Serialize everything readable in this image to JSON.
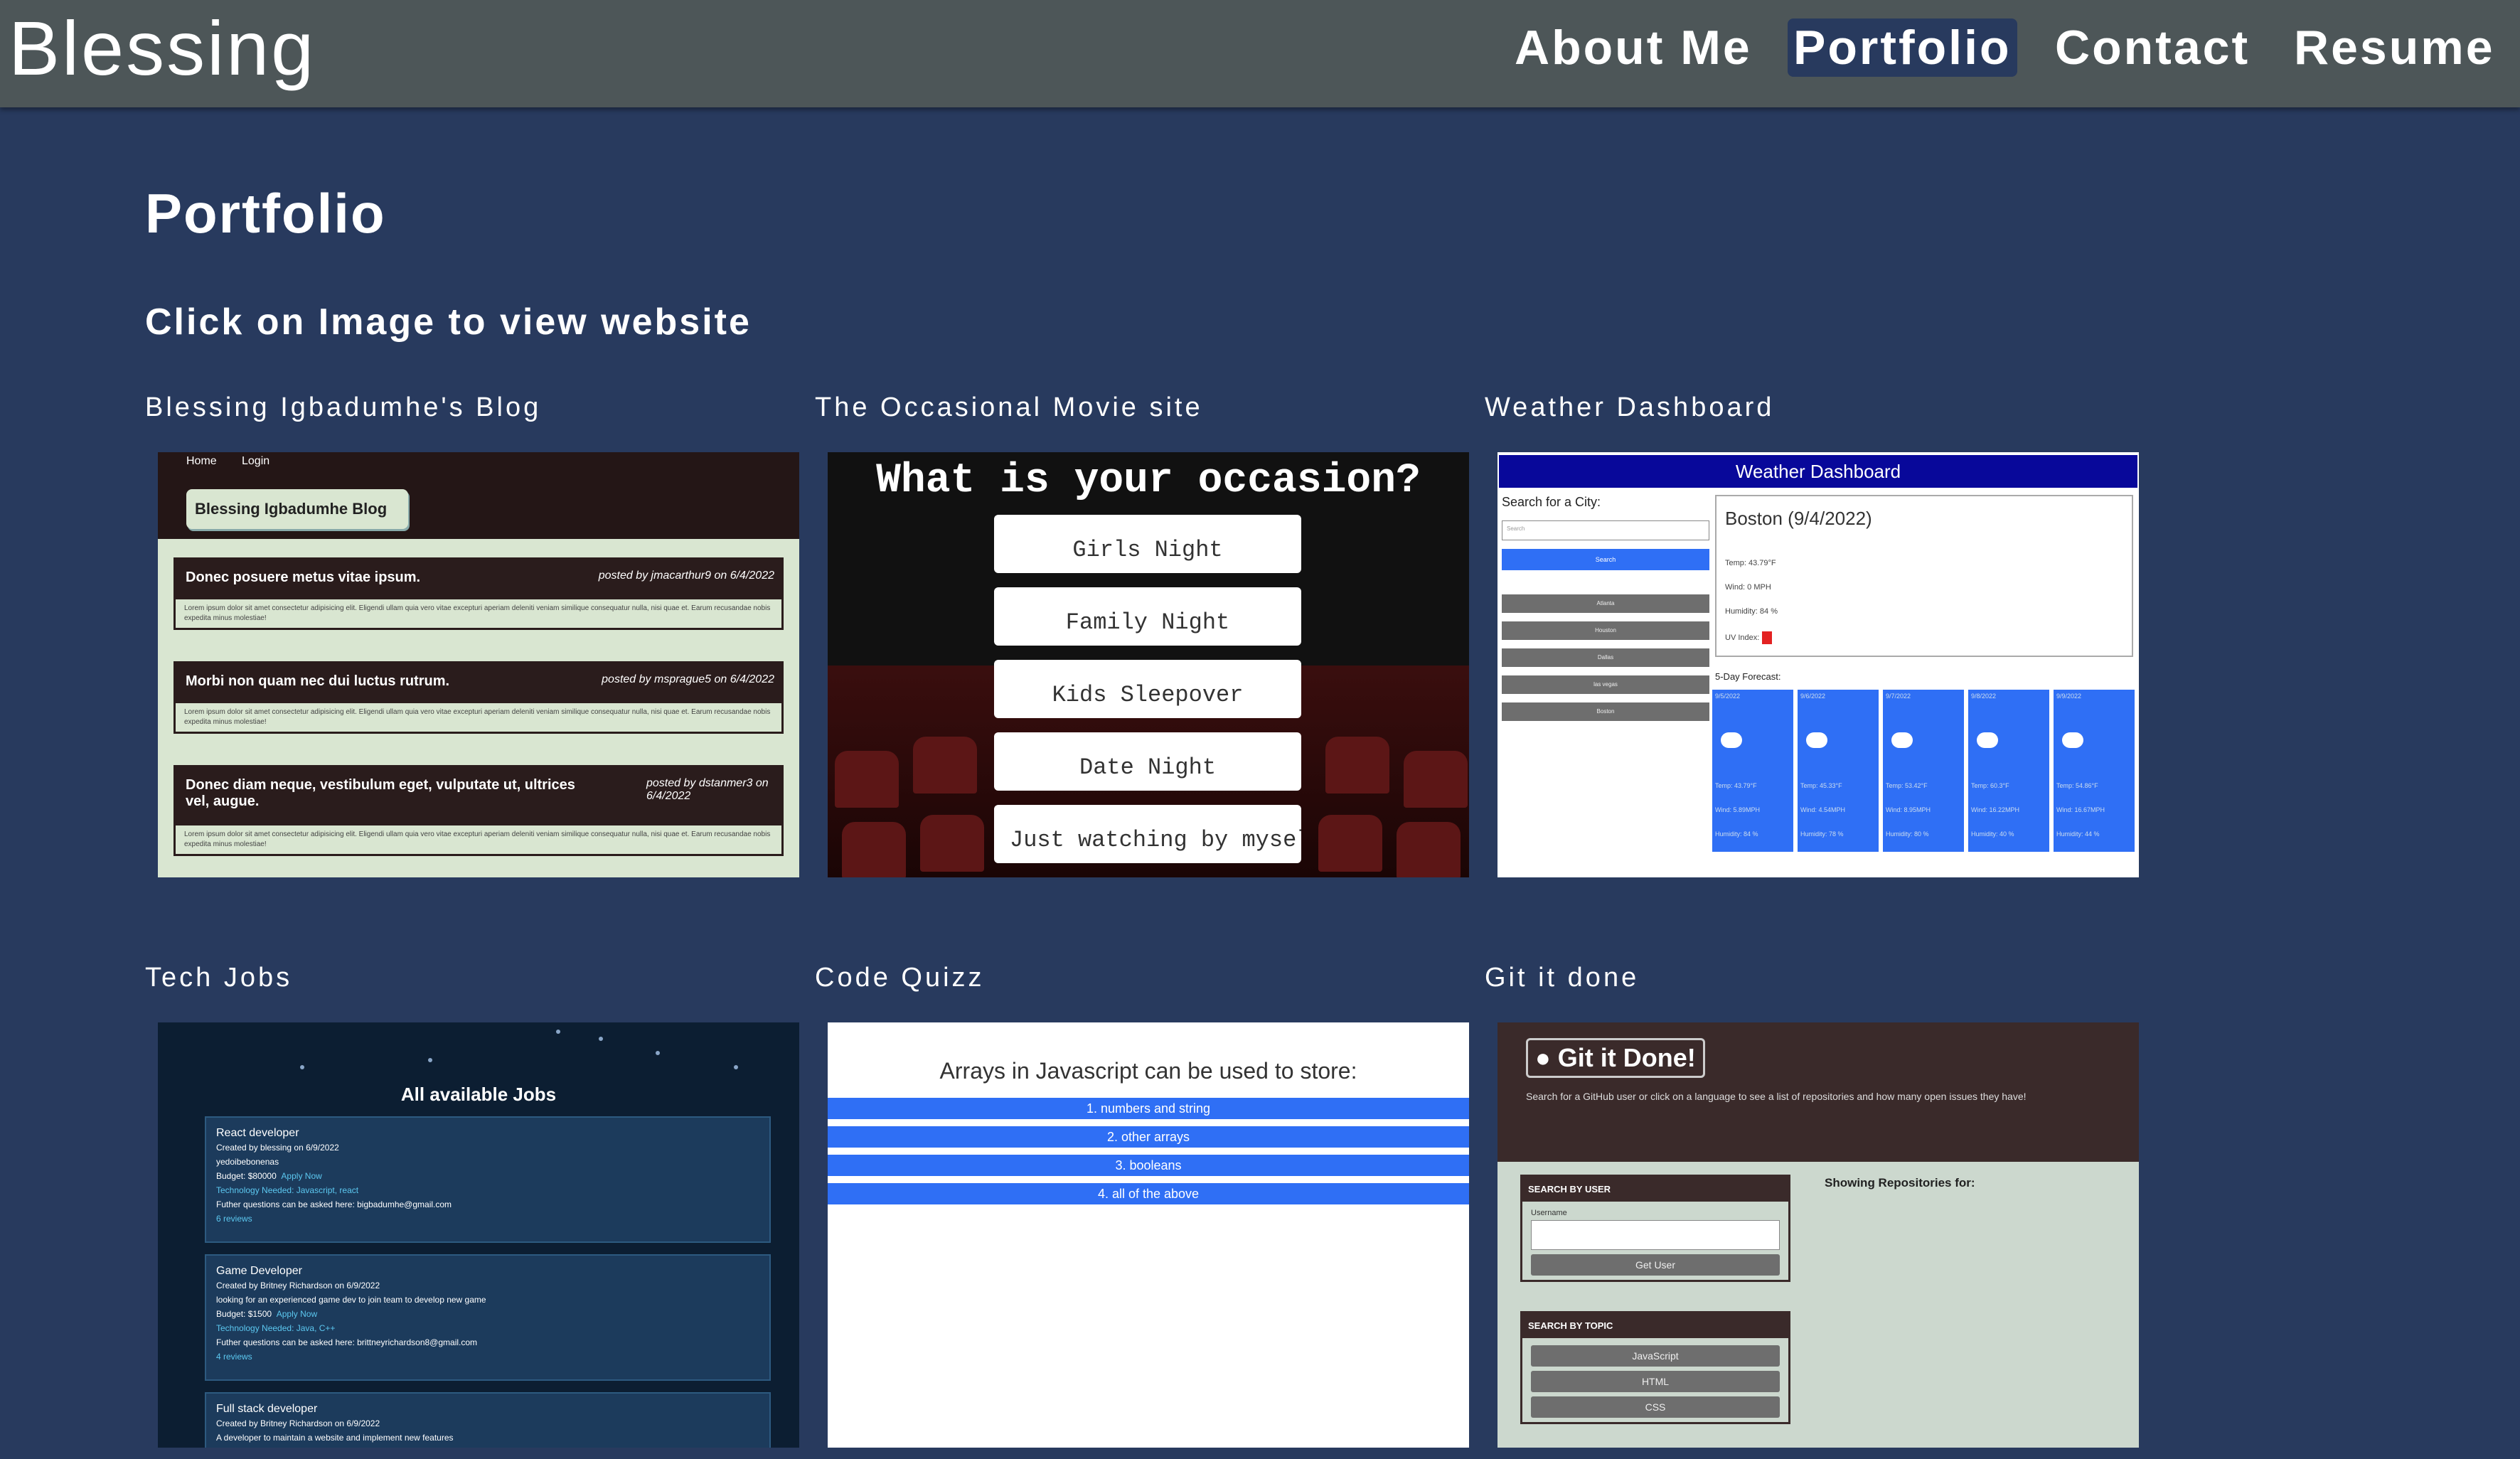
{
  "header": {
    "logo": "Blessing",
    "nav": [
      "About Me",
      "Portfolio",
      "Contact",
      "Resume"
    ],
    "active": "Portfolio"
  },
  "main": {
    "title": "Portfolio",
    "subtitle": "Click on Image to view website"
  },
  "projects": [
    {
      "title": "Blessing Igbadumhe's Blog",
      "screenshot": {
        "nav": [
          "Home",
          "Login"
        ],
        "header": "Blessing Igbadumhe Blog",
        "posts": [
          {
            "title": "Donec posuere metus vitae ipsum.",
            "by": "posted by jmacarthur9 on 6/4/2022",
            "body": "Lorem ipsum dolor sit amet consectetur adipisicing elit. Eligendi ullam quia vero vitae excepturi aperiam deleniti veniam similique consequatur nulla, nisi quae et. Earum recusandae nobis expedita minus molestiae!"
          },
          {
            "title": "Morbi non quam nec dui luctus rutrum.",
            "by": "posted by msprague5 on 6/4/2022",
            "body": "Lorem ipsum dolor sit amet consectetur adipisicing elit. Eligendi ullam quia vero vitae excepturi aperiam deleniti veniam similique consequatur nulla, nisi quae et. Earum recusandae nobis expedita minus molestiae!"
          },
          {
            "title": "Donec diam neque, vestibulum eget, vulputate ut, ultrices vel, augue.",
            "by": "posted by dstanmer3 on 6/4/2022",
            "body": "Lorem ipsum dolor sit amet consectetur adipisicing elit. Eligendi ullam quia vero vitae excepturi aperiam deleniti veniam similique consequatur nulla, nisi quae et. Earum recusandae nobis expedita minus molestiae!"
          }
        ]
      }
    },
    {
      "title": "The Occasional Movie site",
      "screenshot": {
        "question": "What is your occasion?",
        "options": [
          "Girls Night",
          "Family Night",
          "Kids Sleepover",
          "Date Night",
          "Just watching by myself"
        ]
      }
    },
    {
      "title": "Weather Dashboard",
      "screenshot": {
        "header": "Weather Dashboard",
        "search_label": "Search for a City:",
        "search_placeholder": "Search",
        "search_button": "Search",
        "cities": [
          "Atlanta",
          "Houston",
          "Dallas",
          "las vegas",
          "Boston"
        ],
        "city": "Boston (9/4/2022)",
        "stats": [
          "Temp: 43.79°F",
          "Wind: 0 MPH",
          "Humidity: 84 %",
          "UV Index:"
        ],
        "forecast_label": "5-Day Forecast:",
        "forecast": [
          {
            "date": "9/5/2022",
            "temp": "Temp: 43.79°F",
            "wind": "Wind: 5.89MPH",
            "humidity": "Humidity: 84 %"
          },
          {
            "date": "9/6/2022",
            "temp": "Temp: 45.33°F",
            "wind": "Wind: 4.54MPH",
            "humidity": "Humidity: 78 %"
          },
          {
            "date": "9/7/2022",
            "temp": "Temp: 53.42°F",
            "wind": "Wind: 8.95MPH",
            "humidity": "Humidity: 80 %"
          },
          {
            "date": "9/8/2022",
            "temp": "Temp: 60.3°F",
            "wind": "Wind: 16.22MPH",
            "humidity": "Humidity: 40 %"
          },
          {
            "date": "9/9/2022",
            "temp": "Temp: 54.86°F",
            "wind": "Wind: 16.67MPH",
            "humidity": "Humidity: 44 %"
          }
        ]
      }
    },
    {
      "title": "Tech Jobs",
      "screenshot": {
        "header": "All available Jobs",
        "jobs": [
          {
            "title": "React developer",
            "meta": "Created by blessing on 6/9/2022",
            "desc": "yedoibebonenas",
            "budget": "Budget: $80000",
            "apply": "Apply Now",
            "tech": "Technology Needed: Javascript, react",
            "contact": "Futher questions can be asked here: bigbadumhe@gmail.com",
            "reviews": "6 reviews"
          },
          {
            "title": "Game Developer",
            "meta": "Created by Britney Richardson on 6/9/2022",
            "desc": "looking for an experienced game dev to join team to develop new game",
            "budget": "Budget: $1500",
            "apply": "Apply Now",
            "tech": "Technology Needed: Java, C++",
            "contact": "Futher questions can be asked here: brittneyrichardson8@gmail.com",
            "reviews": "4 reviews"
          },
          {
            "title": "Full stack developer",
            "meta": "Created by Britney Richardson on 6/9/2022",
            "desc": "A developer to maintain a website and implement new features"
          }
        ]
      }
    },
    {
      "title": "Code Quizz",
      "screenshot": {
        "question": "Arrays in Javascript can be used to store:",
        "answers": [
          "1. numbers and string",
          "2. other arrays",
          "3. booleans",
          "4. all of the above"
        ]
      }
    },
    {
      "title": "Git it done",
      "screenshot": {
        "header": "Git it Done!",
        "desc": "Search for a GitHub user or click on a language to see a list of repositories and how many open issues they have!",
        "user_panel": "SEARCH BY USER",
        "username_label": "Username",
        "user_button": "Get User",
        "topic_panel": "SEARCH BY TOPIC",
        "topics": [
          "JavaScript",
          "HTML",
          "CSS"
        ],
        "repos": "Showing Repositories for:"
      }
    }
  ]
}
